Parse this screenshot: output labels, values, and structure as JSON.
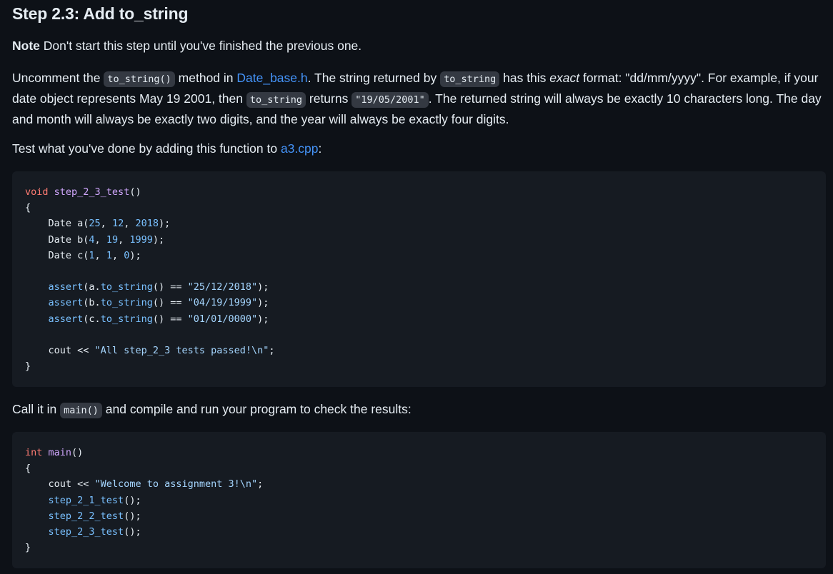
{
  "heading": "Step 2.3: Add to_string",
  "note": {
    "label": "Note",
    "text": " Don't start this step until you've finished the previous one."
  },
  "body": {
    "t1": "Uncomment the ",
    "code_to_string_call": "to_string()",
    "t2": " method in ",
    "link_date_base": "Date_base.h",
    "t3": ". The string returned by ",
    "code_to_string": "to_string",
    "t4": " has this ",
    "em_exact": "exact",
    "t5": " format: \"dd/mm/yyyy\". For example, if your date object represents May 19 2001, then ",
    "code_to_string_2": "to_string",
    "t6": " returns ",
    "code_example": "\"19/05/2001\"",
    "t7": ". The returned string will always be exactly 10 characters long. The day and month will always be exactly two digits, and the year will always be exactly four digits."
  },
  "test_para": {
    "text": "Test what you've done by adding this function to ",
    "link": "a3.cpp",
    "end": ":"
  },
  "code_test": {
    "l1_kw": "void",
    "l1_fn": "step_2_3_test",
    "l1_end": "()",
    "open": "{",
    "a_pre": "    Date a(",
    "a_n1": "25",
    "a_n2": "12",
    "a_n3": "2018",
    "b_pre": "    Date b(",
    "b_n1": "4",
    "b_n2": "19",
    "b_n3": "1999",
    "c_pre": "    Date c(",
    "c_n1": "1",
    "c_n2": "1",
    "c_n3": "0",
    "as1_fn": "assert",
    "as1_obj": "(a.",
    "as1_call": "to_string",
    "as1_eq": "() == ",
    "as1_str": "\"25/12/2018\"",
    "as2_fn": "assert",
    "as2_obj": "(b.",
    "as2_call": "to_string",
    "as2_eq": "() == ",
    "as2_str": "\"04/19/1999\"",
    "as3_fn": "assert",
    "as3_obj": "(c.",
    "as3_call": "to_string",
    "as3_eq": "() == ",
    "as3_str": "\"01/01/0000\"",
    "cout_pre": "    cout << ",
    "cout_str": "\"All step_2_3 tests passed!\\n\"",
    "close": "}"
  },
  "call_para": {
    "t1": "Call it in ",
    "code_main": "main()",
    "t2": " and compile and run your program to check the results:"
  },
  "code_main": {
    "l1_kw": "int",
    "l1_fn": "main",
    "l1_end": "()",
    "open": "{",
    "cout_pre": "    cout << ",
    "cout_str": "\"Welcome to assignment 3!\\n\"",
    "call1": "step_2_1_test",
    "call2": "step_2_2_test",
    "call3": "step_2_3_test",
    "call_end": "();",
    "close": "}"
  }
}
